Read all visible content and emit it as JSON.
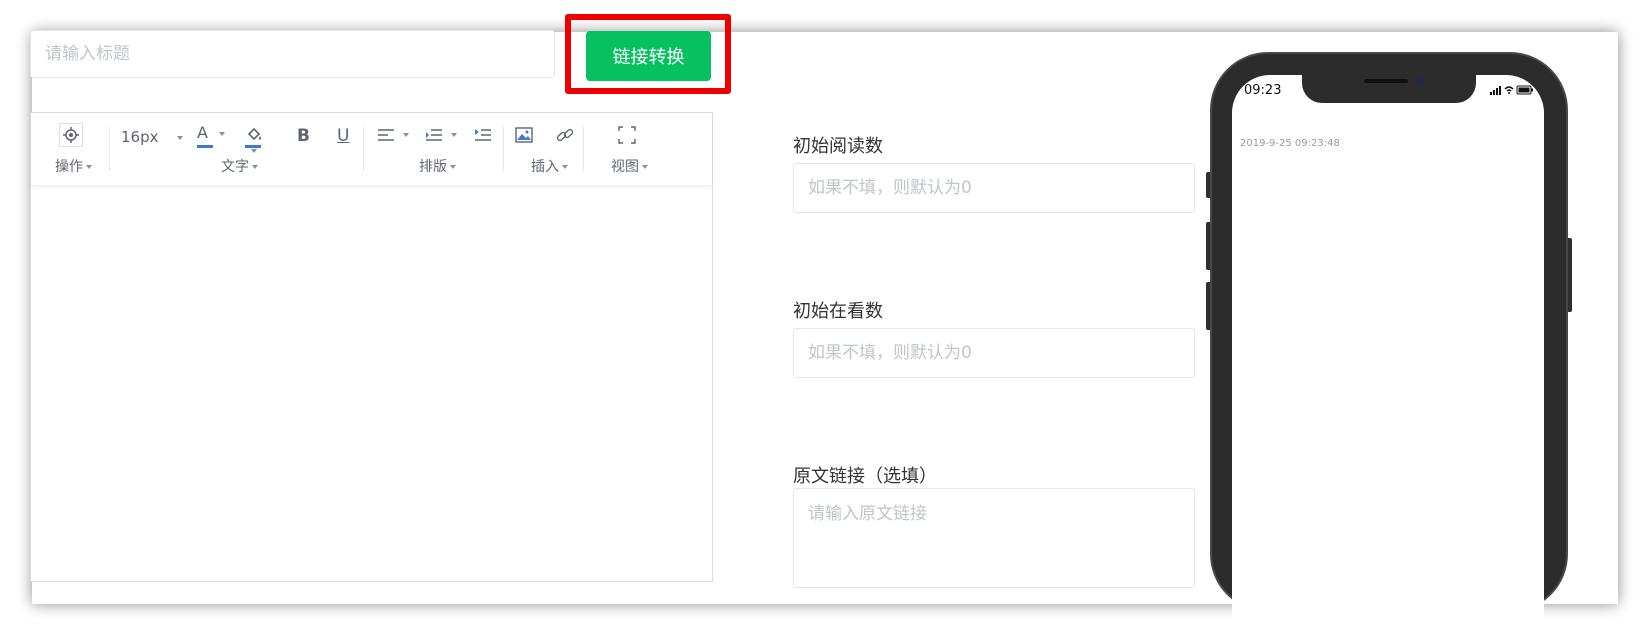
{
  "header": {
    "title_placeholder": "请输入标题",
    "convert_label": "链接转换"
  },
  "toolbar": {
    "font_size": "16px",
    "bold": "B",
    "underline": "U",
    "color_letter": "A",
    "groups": {
      "operation": "操作",
      "text": "文字",
      "layout": "排版",
      "insert": "插入",
      "view": "视图"
    }
  },
  "form": {
    "read_count_label": "初始阅读数",
    "read_count_placeholder": "如果不填，则默认为0",
    "watch_count_label": "初始在看数",
    "watch_count_placeholder": "如果不填，则默认为0",
    "source_link_label": "原文链接（选填）",
    "source_link_placeholder": "请输入原文链接"
  },
  "preview": {
    "time": "09:23",
    "date": "2019-9-25 09:23:48"
  },
  "colors": {
    "accent": "#07c160",
    "highlight_border": "#ee0000",
    "toolbar_icon_blue": "#3a7bd5"
  },
  "icons": [
    "settings-icon",
    "font-color-icon",
    "fill-color-icon",
    "bold-icon",
    "underline-icon",
    "align-icon",
    "indent-icon",
    "line-height-icon",
    "image-icon",
    "link-icon",
    "fullscreen-icon",
    "signal-icon",
    "wifi-icon",
    "battery-icon"
  ]
}
